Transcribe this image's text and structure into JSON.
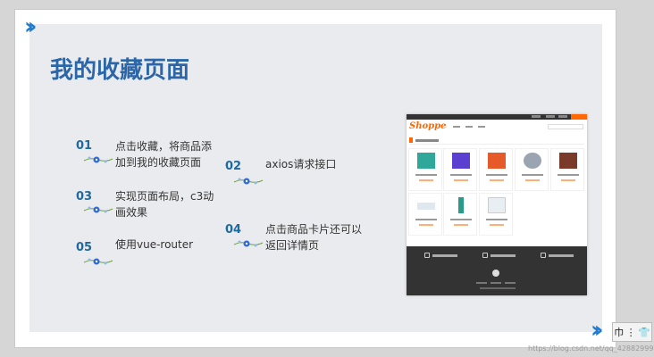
{
  "slide": {
    "title": "我的收藏页面",
    "items": [
      {
        "num": "01",
        "lines": [
          "点击收藏，将商品添",
          "加到我的收藏页面"
        ]
      },
      {
        "num": "02",
        "lines": [
          "axios请求接口"
        ]
      },
      {
        "num": "03",
        "lines": [
          "实现页面布局，c3动",
          "画效果"
        ]
      },
      {
        "num": "04",
        "lines": [
          "点击商品卡片还可以",
          "返回详情页"
        ]
      },
      {
        "num": "05",
        "lines": [
          "使用vue-router"
        ]
      }
    ]
  },
  "screenshot": {
    "logo": "Shoppe",
    "accent": "#ff6700",
    "product_image_colors": [
      "#2fa89a",
      "#5b3fd1",
      "#e65a2a",
      "#9aa5b1",
      "#7a3b2a",
      "#dfe8ef",
      "#2a9a8a",
      "#e9eef2"
    ]
  },
  "widgets": {
    "icon1": "巾",
    "icon2": "⋮",
    "icon3": "👕"
  },
  "watermark": "https://blog.csdn.net/qq_42882999"
}
